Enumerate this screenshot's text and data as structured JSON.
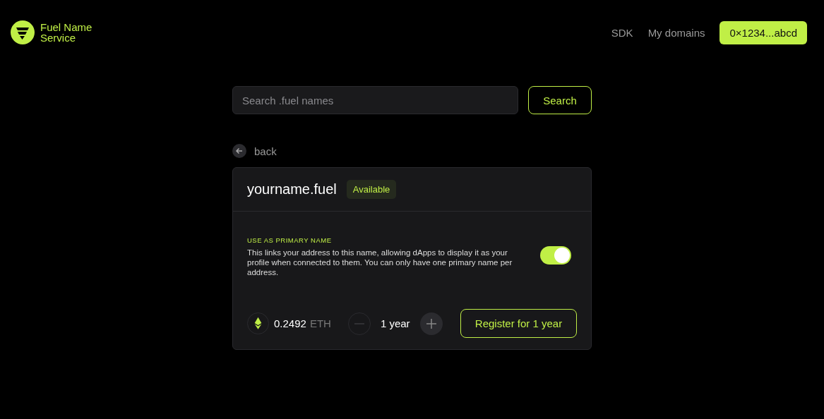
{
  "header": {
    "brand": "Fuel Name Service",
    "nav": [
      "SDK",
      "My domains"
    ],
    "wallet": "0×1234...abcd"
  },
  "search": {
    "placeholder": "Search .fuel names",
    "button": "Search"
  },
  "back": "back",
  "domain": {
    "name": "yourname.fuel",
    "status": "Available",
    "primary": {
      "title": "USE AS PRIMARY NAME",
      "description": "This links your address to this name, allowing dApps to display it as your profile when connected to them. You can only have one primary name per address.",
      "on": true
    },
    "price": {
      "amount": "0.2492",
      "unit": "ETH"
    },
    "period": {
      "label": "1 year",
      "decrement_disabled": true,
      "increment_disabled": false
    },
    "register": "Register for 1 year"
  }
}
